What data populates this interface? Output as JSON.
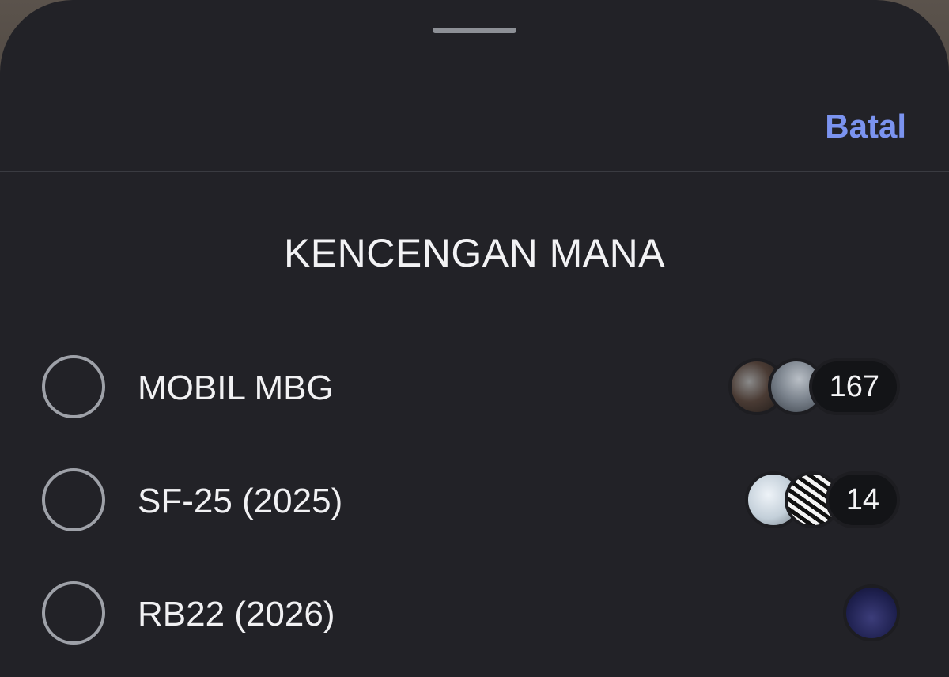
{
  "header": {
    "cancel_label": "Batal"
  },
  "poll": {
    "question": "KENCENGAN MANA",
    "options": [
      {
        "label": "MOBIL MBG",
        "votes": "167",
        "avatars": [
          "voter-avatar",
          "voter-avatar"
        ]
      },
      {
        "label": "SF-25 (2025)",
        "votes": "14",
        "avatars": [
          "voter-avatar",
          "voter-avatar"
        ]
      },
      {
        "label": "RB22 (2026)",
        "votes": "",
        "avatars": [
          "voter-avatar"
        ]
      }
    ]
  },
  "colors": {
    "sheet_background": "#222227",
    "accent": "#7b93ef",
    "radio_border": "#9ea1a8",
    "count_pill": "#131417"
  }
}
